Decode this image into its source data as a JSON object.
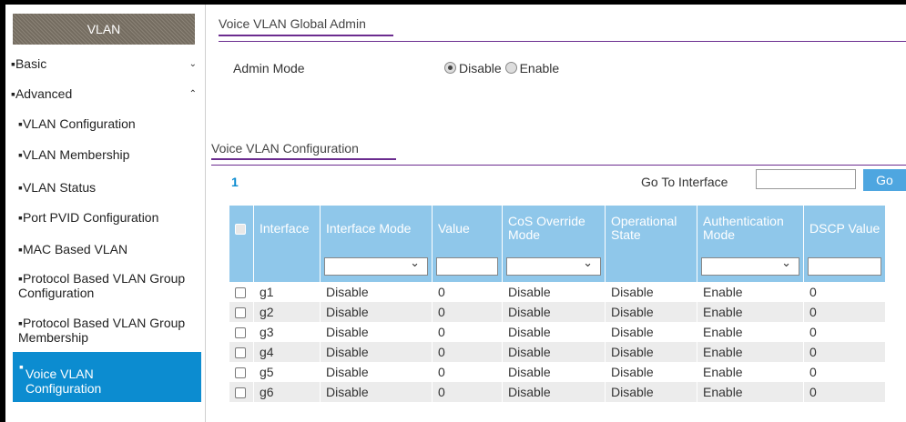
{
  "sidebar": {
    "title": "VLAN",
    "items": [
      {
        "label": "Basic",
        "chevron": "chevron-down"
      },
      {
        "label": "Advanced",
        "chevron": "chevron-up"
      }
    ],
    "subitems": [
      "VLAN Configuration",
      "VLAN Membership",
      "VLAN Status",
      "Port PVID Configuration",
      "MAC Based VLAN",
      "Protocol Based VLAN Group Configuration",
      "Protocol Based VLAN Group Membership"
    ],
    "active_item": "Voice VLAN Configuration"
  },
  "global_admin": {
    "title": "Voice VLAN Global Admin",
    "admin_mode_label": "Admin Mode",
    "options": [
      "Disable",
      "Enable"
    ],
    "selected": "Disable"
  },
  "config": {
    "title": "Voice VLAN Configuration",
    "page_number": "1",
    "goto_label": "Go To Interface",
    "goto_value": "",
    "go_button": "Go"
  },
  "table": {
    "columns": [
      "Interface",
      "Interface Mode",
      "Value",
      "CoS Override Mode",
      "Operational State",
      "Authentication Mode",
      "DSCP Value"
    ],
    "rows": [
      [
        "g1",
        "Disable",
        "0",
        "Disable",
        "Disable",
        "Enable",
        "0"
      ],
      [
        "g2",
        "Disable",
        "0",
        "Disable",
        "Disable",
        "Enable",
        "0"
      ],
      [
        "g3",
        "Disable",
        "0",
        "Disable",
        "Disable",
        "Enable",
        "0"
      ],
      [
        "g4",
        "Disable",
        "0",
        "Disable",
        "Disable",
        "Enable",
        "0"
      ],
      [
        "g5",
        "Disable",
        "0",
        "Disable",
        "Disable",
        "Enable",
        "0"
      ],
      [
        "g6",
        "Disable",
        "0",
        "Disable",
        "Disable",
        "Enable",
        "0"
      ]
    ]
  },
  "colors": {
    "accent_blue": "#0c8cd0",
    "table_header": "#8fc7ea",
    "section_line": "#6b2c8f"
  }
}
